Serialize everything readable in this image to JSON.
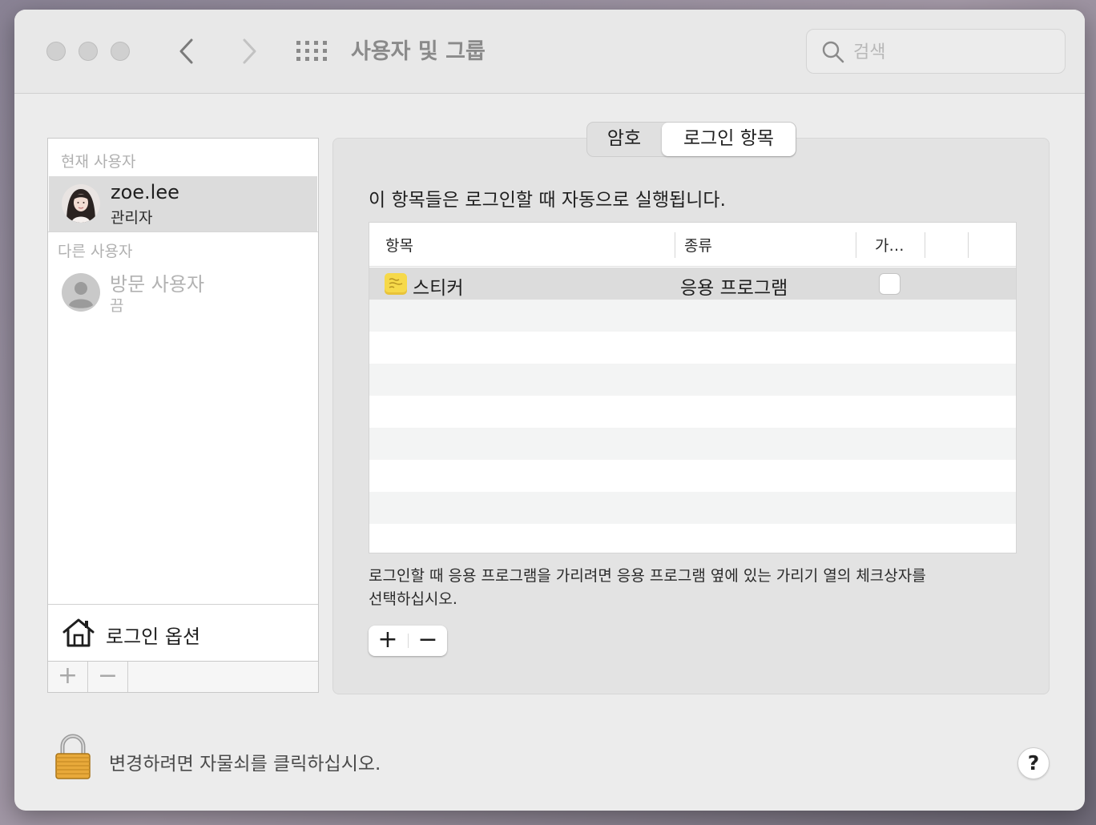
{
  "window": {
    "title": "사용자 및 그룹"
  },
  "search": {
    "placeholder": "검색",
    "value": ""
  },
  "sidebar": {
    "current_label": "현재 사용자",
    "current_user": {
      "name": "zoe.lee",
      "role": "관리자"
    },
    "other_label": "다른 사용자",
    "guest_user": {
      "name": "방문 사용자",
      "state": "끔"
    },
    "login_options_label": "로그인 옵션",
    "add_label": "+",
    "remove_label": "−"
  },
  "tabs": [
    {
      "label": "암호",
      "active": false
    },
    {
      "label": "로그인 항목",
      "active": true
    }
  ],
  "main": {
    "description": "이 항목들은 로그인할 때 자동으로 실행됩니다.",
    "table": {
      "headers": [
        "항목",
        "종류",
        "가…"
      ],
      "rows": [
        {
          "item": "스티커",
          "kind": "응용 프로그램",
          "hide": false
        }
      ]
    },
    "hint": "로그인할 때 응용 프로그램을 가리려면 응용 프로그램 옆에 있는 가리기 열의 체크상자를 선택하십시오.",
    "add_label": "+",
    "remove_label": "−"
  },
  "footer": {
    "lock_text": "변경하려면 자물쇠를 클릭하십시오.",
    "help_label": "?"
  },
  "colors": {
    "selection": "#dcdcdc",
    "window": "#ececec",
    "sticky_icon": "#f6d94a"
  },
  "icons": [
    "back-icon",
    "forward-icon",
    "grid-icon",
    "search-icon",
    "house-icon",
    "lock-icon",
    "sticky-notes-icon",
    "guest-avatar-icon"
  ]
}
